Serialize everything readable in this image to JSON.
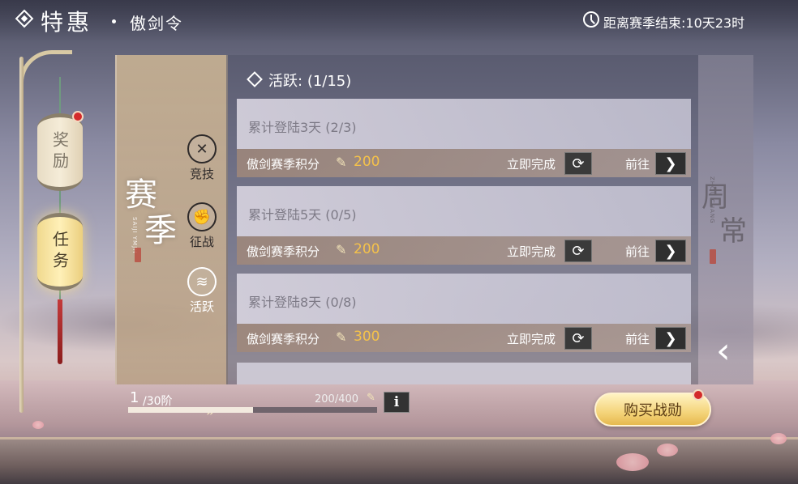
{
  "header": {
    "title": "特惠",
    "subtitle": "傲剑令",
    "season_timer": "距离赛季结束:10天23时"
  },
  "side_nav": {
    "tabs": [
      {
        "label": "奖励",
        "active": false,
        "has_notification": true
      },
      {
        "label": "任务",
        "active": true,
        "has_notification": false
      }
    ]
  },
  "season_panel": {
    "title_chars": [
      "赛",
      "季"
    ],
    "pinyin": "SAIJI YMJH",
    "categories": [
      {
        "label": "竞技",
        "icon": "crossed-swords-icon",
        "active": false
      },
      {
        "label": "征战",
        "icon": "fist-icon",
        "active": false
      },
      {
        "label": "活跃",
        "icon": "bird-icon",
        "active": true
      }
    ]
  },
  "task_list": {
    "section_title": "活跃:",
    "section_progress": "(1/15)",
    "reward_name": "傲剑赛季积分",
    "complete_label": "立即完成",
    "goto_label": "前往",
    "tasks": [
      {
        "name": "累计登陆3天",
        "progress": "(2/3)",
        "reward": "200"
      },
      {
        "name": "累计登陆5天",
        "progress": "(0/5)",
        "reward": "200"
      },
      {
        "name": "累计登陆8天",
        "progress": "(0/8)",
        "reward": "300"
      }
    ]
  },
  "daily_panel": {
    "title_chars": [
      "周",
      "常"
    ],
    "pinyin": "ZHOU CHANG"
  },
  "progress": {
    "current_tier": "1",
    "total_tiers": "/30阶",
    "xp_text": "200/400",
    "fraction": 0.5
  },
  "buy_button": {
    "label": "购买战勋",
    "has_notification": true
  },
  "colors": {
    "accent_gold": "#f5c24a",
    "notification_red": "#d42a2a"
  }
}
